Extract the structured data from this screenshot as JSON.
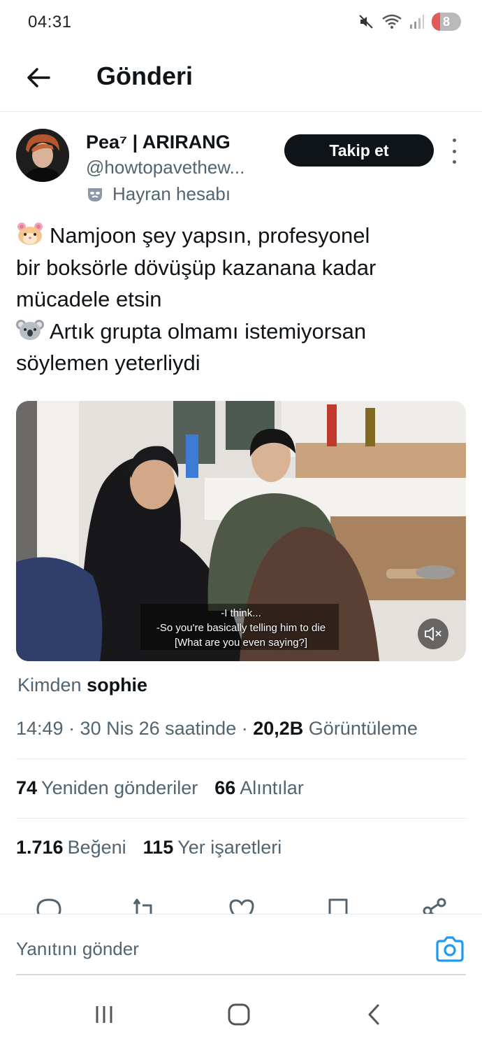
{
  "status_bar": {
    "time": "04:31",
    "battery_level": "8"
  },
  "header": {
    "title": "Gönderi"
  },
  "author": {
    "name": "Pea⁷ | ARIRANG",
    "handle": "@howtopavethew...",
    "label": "Hayran hesabı",
    "follow_label": "Takip et"
  },
  "tweet": {
    "lines": [
      "Namjoon şey yapsın, profesyonel",
      "bir boksörle dövüşüp kazanana kadar",
      "mücadele etsin",
      "Artık grupta olmamı istemiyorsan",
      "söylemen yeterliydi"
    ],
    "emojis": [
      "hamster-face",
      "koala-face"
    ]
  },
  "media": {
    "subtitles": [
      "-I think...",
      "-So you're basically telling him to die",
      "[What are you even saying?]"
    ]
  },
  "from": {
    "prefix": "Kimden",
    "name": "sophie"
  },
  "meta": {
    "time_date": "14:49 · 30 Nis 26 saatinde ·",
    "views_count": "20,2B",
    "views_label": "Görüntüleme"
  },
  "stats": {
    "retweets_count": "74",
    "retweets_label": "Yeniden gönderiler",
    "quotes_count": "66",
    "quotes_label": "Alıntılar",
    "likes_count": "1.716",
    "likes_label": "Beğeni",
    "bookmarks_count": "115",
    "bookmarks_label": "Yer işaretleri"
  },
  "reply": {
    "placeholder": "Yanıtını gönder"
  },
  "icons": {
    "accent": "#1d9bf0",
    "text_primary": "#0f1419",
    "text_secondary": "#536471"
  }
}
